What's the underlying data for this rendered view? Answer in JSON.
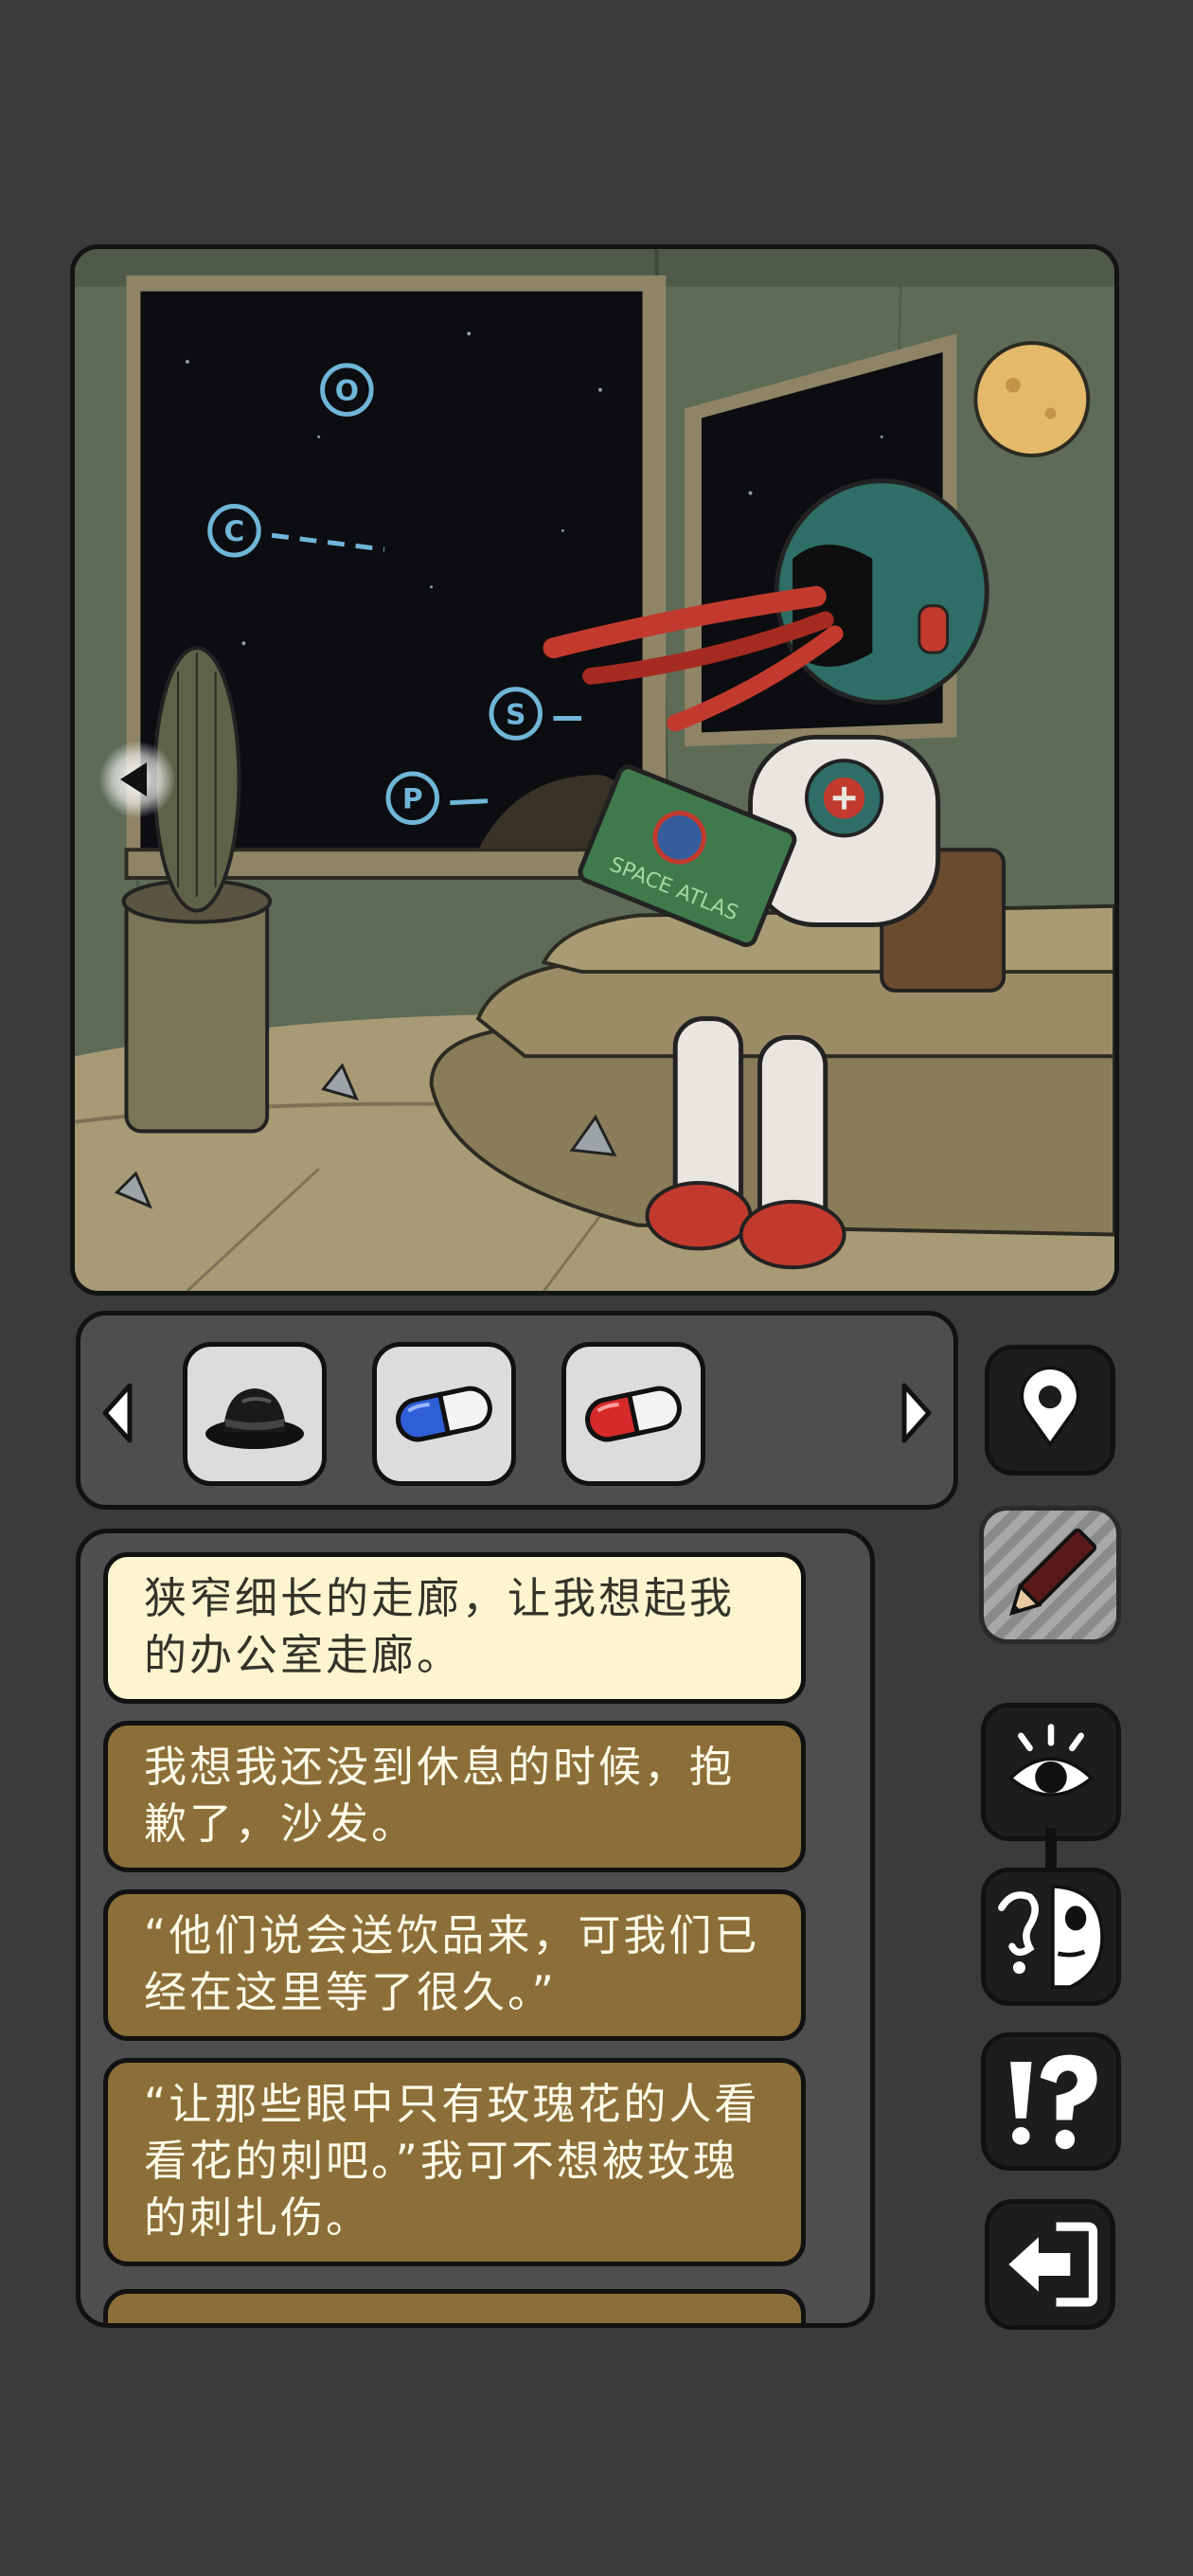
{
  "scene": {
    "name": "rusty-lake-room",
    "book_title": "SPACE ATLAS",
    "window_letters": [
      "O",
      "C",
      "S",
      "P"
    ],
    "nav_left": "previous-scene"
  },
  "inventory": {
    "items": [
      {
        "name": "black-hat",
        "icon": "hat-icon"
      },
      {
        "name": "blue-pill",
        "icon": "blue-pill-icon"
      },
      {
        "name": "red-pill",
        "icon": "red-pill-icon"
      }
    ]
  },
  "sidebar": {
    "buttons": [
      "map-pin-icon",
      "pencil-icon",
      "eye-icon",
      "face-icon",
      "hint-icon",
      "exit-icon"
    ]
  },
  "notebook": {
    "notes": [
      {
        "text": "狭窄细长的走廊，让我想起我的办公室走廊。",
        "active": true
      },
      {
        "text": "我想我还没到休息的时候，抱歉了，沙发。",
        "active": false
      },
      {
        "text": "“他们说会送饮品来，可我们已经在这里等了很久。”",
        "active": false
      },
      {
        "text": "“让那些眼中只有玫瑰花的人看看花的刺吧。”我可不想被玫瑰的刺扎伤。",
        "active": false
      }
    ]
  },
  "colors": {
    "background": "#3b3b3d",
    "panel": "#4e4e50",
    "note": "#8c6f38",
    "note_active": "#fdf5cf"
  }
}
